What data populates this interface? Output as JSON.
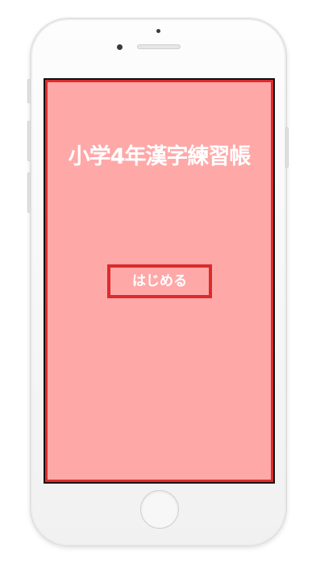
{
  "app": {
    "title": "小学4年漢字練習帳",
    "start_label": "はじめる"
  },
  "colors": {
    "background": "#ffa8a8",
    "accent": "#dd2b2b",
    "text": "#ffffff"
  }
}
